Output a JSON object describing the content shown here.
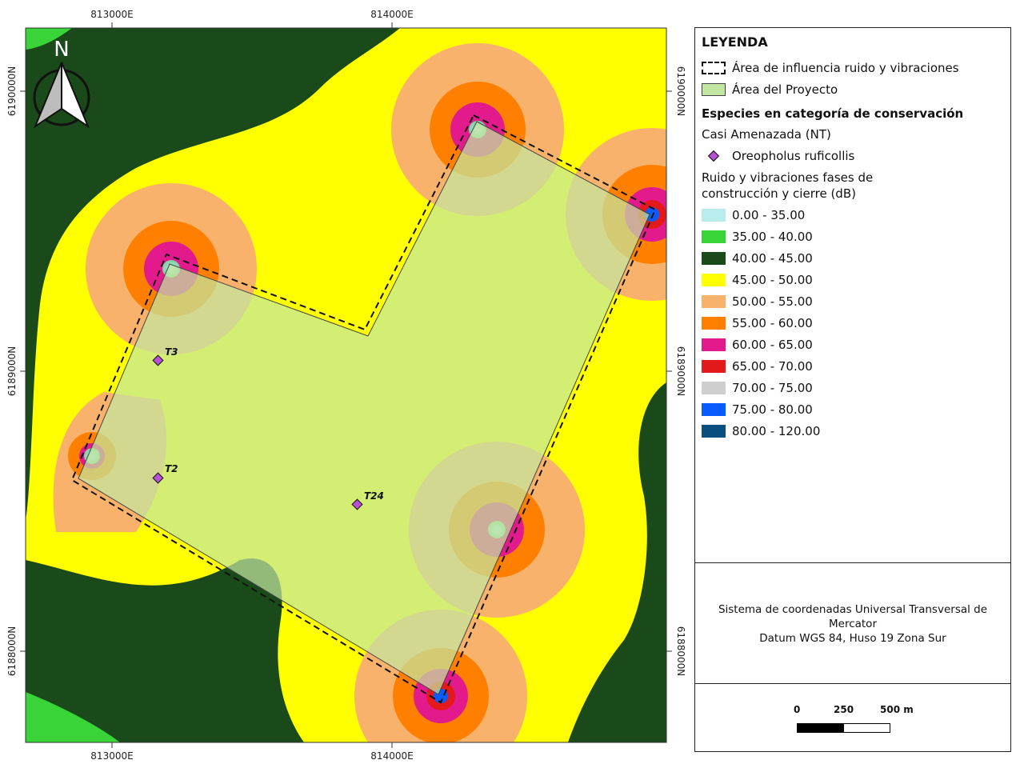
{
  "map": {
    "north_label": "N",
    "x_ticks": [
      "813000E",
      "814000E"
    ],
    "y_ticks": [
      "6190000N",
      "6189000N",
      "6188000N"
    ],
    "points": [
      {
        "label": "T3"
      },
      {
        "label": "T2"
      },
      {
        "label": "T24"
      }
    ]
  },
  "legend": {
    "title": "LEYENDA",
    "influence_label": "Área de influencia ruido y vibraciones",
    "project_label": "Área del Proyecto",
    "species_heading": "Especies en categoría de conservación",
    "category_label": "Casi Amenazada (NT)",
    "species_label": "Oreopholus ruficollis",
    "noise_heading": "Ruido y vibraciones fases de construcción y cierre (dB)",
    "classes": [
      {
        "label": "0.00 - 35.00",
        "color": "#b9ecec"
      },
      {
        "label": "35.00 - 40.00",
        "color": "#38d438"
      },
      {
        "label": "40.00 - 45.00",
        "color": "#1a4a1a"
      },
      {
        "label": "45.00 - 50.00",
        "color": "#ffff00"
      },
      {
        "label": "50.00 - 55.00",
        "color": "#f9b26b"
      },
      {
        "label": "55.00 - 60.00",
        "color": "#ff8000"
      },
      {
        "label": "60.00 - 65.00",
        "color": "#e31a8c"
      },
      {
        "label": "65.00 - 70.00",
        "color": "#e3191c"
      },
      {
        "label": "70.00 - 75.00",
        "color": "#cfcfcf"
      },
      {
        "label": "75.00 - 80.00",
        "color": "#0a5cff"
      },
      {
        "label": "80.00 - 120.00",
        "color": "#0b4f80"
      }
    ],
    "project_color": "#c3e6a0",
    "species_color": "#b84fd6"
  },
  "crs": {
    "line1": "Sistema de coordenadas Universal Transversal de Mercator",
    "line2": "Datum WGS 84, Huso 19 Zona Sur"
  },
  "scalebar": {
    "labels": [
      "0",
      "250",
      "500 m"
    ]
  }
}
